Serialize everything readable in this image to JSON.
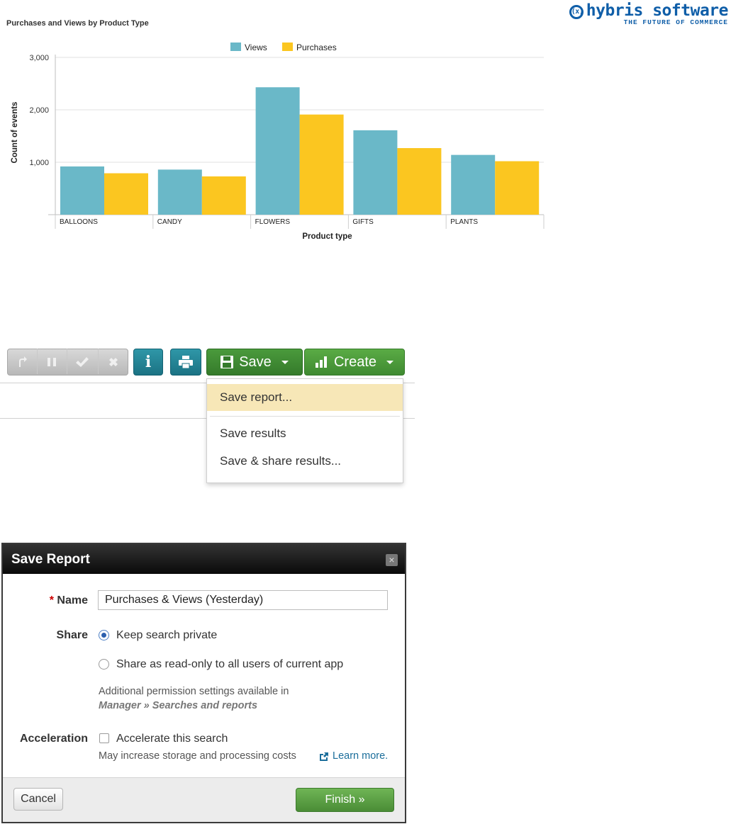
{
  "chart_data": {
    "type": "bar",
    "title": "Purchases and Views by Product Type",
    "xlabel": "Product type",
    "ylabel": "Count of events",
    "categories": [
      "BALLOONS",
      "CANDY",
      "FLOWERS",
      "GIFTS",
      "PLANTS"
    ],
    "series": [
      {
        "name": "Views",
        "values": [
          920,
          860,
          2430,
          1610,
          1140
        ],
        "color": "#6ab8c8"
      },
      {
        "name": "Purchases",
        "values": [
          790,
          730,
          1910,
          1270,
          1020
        ],
        "color": "#fbc620"
      }
    ],
    "ylim": [
      0,
      3000
    ],
    "yticks": [
      1000,
      2000,
      3000
    ],
    "ytick_labels": [
      "1,000",
      "2,000",
      "3,000"
    ],
    "grid": true,
    "legend_position": "top-center"
  },
  "logo": {
    "name": "hybris software",
    "tagline": "THE FUTURE OF COMMERCE",
    "mark": "(x)",
    "color": "#0f5ea8"
  },
  "toolbar": {
    "disabled_icons": [
      "redo-icon",
      "pause-icon",
      "check-icon",
      "close-icon"
    ],
    "save_label": "Save",
    "create_label": "Create"
  },
  "save_menu": {
    "items": [
      "Save report...",
      "Save results",
      "Save & share results..."
    ],
    "highlighted": "Save report..."
  },
  "dialog": {
    "title": "Save Report",
    "required_mark": "*",
    "name_label": "Name",
    "name_value": "Purchases & Views (Yesterday)",
    "share_label": "Share",
    "share_private": "Keep search private",
    "share_readonly": "Share as read-only to all users of current app",
    "share_selected": "Keep search private",
    "permissions_note": "Additional permission settings available in",
    "permissions_path": "Manager » Searches and reports",
    "acceleration_label": "Acceleration",
    "accelerate_option": "Accelerate this search",
    "accelerate_checked": false,
    "accelerate_note": "May increase storage and processing costs",
    "learn_more": "Learn more.",
    "cancel_label": "Cancel",
    "finish_label": "Finish »"
  }
}
